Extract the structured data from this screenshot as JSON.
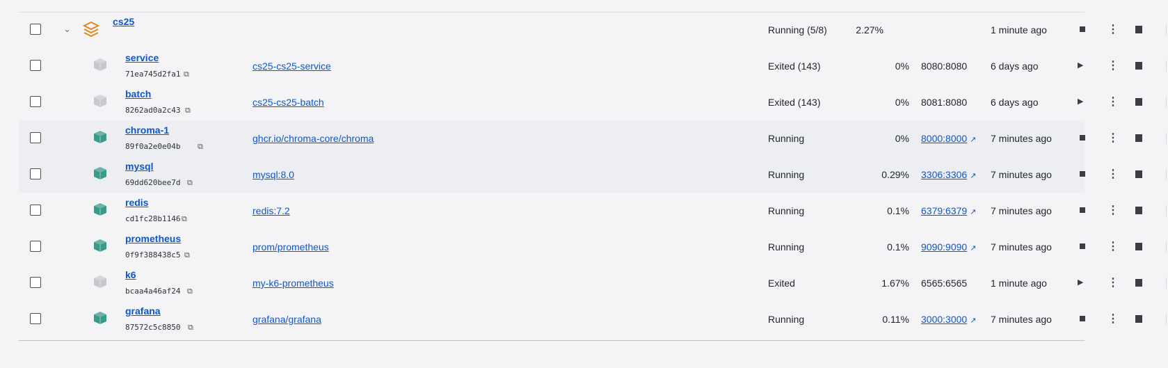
{
  "group": {
    "name": "cs25",
    "status": "Running (5/8)",
    "cpu": "2.27%",
    "started": "1 minute ago"
  },
  "containers": [
    {
      "name": "service",
      "id": "71ea745d2fa1",
      "image": "cs25-cs25-service",
      "status": "Exited (143)",
      "cpu": "0%",
      "ports": "8080:8080",
      "ports_link": false,
      "started": "6 days ago",
      "running": false
    },
    {
      "name": "batch",
      "id": "8262ad0a2c43",
      "image": "cs25-cs25-batch",
      "status": "Exited (143)",
      "cpu": "0%",
      "ports": "8081:8080",
      "ports_link": false,
      "started": "6 days ago",
      "running": false
    },
    {
      "name": "chroma-1",
      "id": "89f0a2e0e04b",
      "image": "ghcr.io/chroma-core/chroma",
      "status": "Running",
      "cpu": "0%",
      "ports": "8000:8000",
      "ports_link": true,
      "started": "7 minutes ago",
      "running": true
    },
    {
      "name": "mysql",
      "id": "69dd620bee7d",
      "image": "mysql:8.0",
      "status": "Running",
      "cpu": "0.29%",
      "ports": "3306:3306",
      "ports_link": true,
      "started": "7 minutes ago",
      "running": true
    },
    {
      "name": "redis",
      "id": "cd1fc28b1146",
      "image": "redis:7.2",
      "status": "Running",
      "cpu": "0.1%",
      "ports": "6379:6379",
      "ports_link": true,
      "started": "7 minutes ago",
      "running": true
    },
    {
      "name": "prometheus",
      "id": "0f9f388438c5",
      "image": "prom/prometheus",
      "status": "Running",
      "cpu": "0.1%",
      "ports": "9090:9090",
      "ports_link": true,
      "started": "7 minutes ago",
      "running": true
    },
    {
      "name": "k6",
      "id": "bcaa4a46af24",
      "image": "my-k6-prometheus",
      "status": "Exited",
      "cpu": "1.67%",
      "ports": "6565:6565",
      "ports_link": false,
      "started": "1 minute ago",
      "running": false
    },
    {
      "name": "grafana",
      "id": "87572c5c8850",
      "image": "grafana/grafana",
      "status": "Running",
      "cpu": "0.11%",
      "ports": "3000:3000",
      "ports_link": true,
      "started": "7 minutes ago",
      "running": true
    }
  ],
  "colors": {
    "link": "#0b57d0",
    "running_icon": "#3a9b8a",
    "stopped_icon": "#c7c9cc",
    "stack_icon": "#e08a17"
  },
  "icons": {
    "stack": "stack-icon",
    "container": "container-icon",
    "copy": "copy-icon",
    "external": "external-link-icon",
    "stop": "stop-icon",
    "play": "play-icon",
    "more": "more-vert-icon",
    "delete": "trash-icon",
    "expand": "chevron-down-icon"
  }
}
